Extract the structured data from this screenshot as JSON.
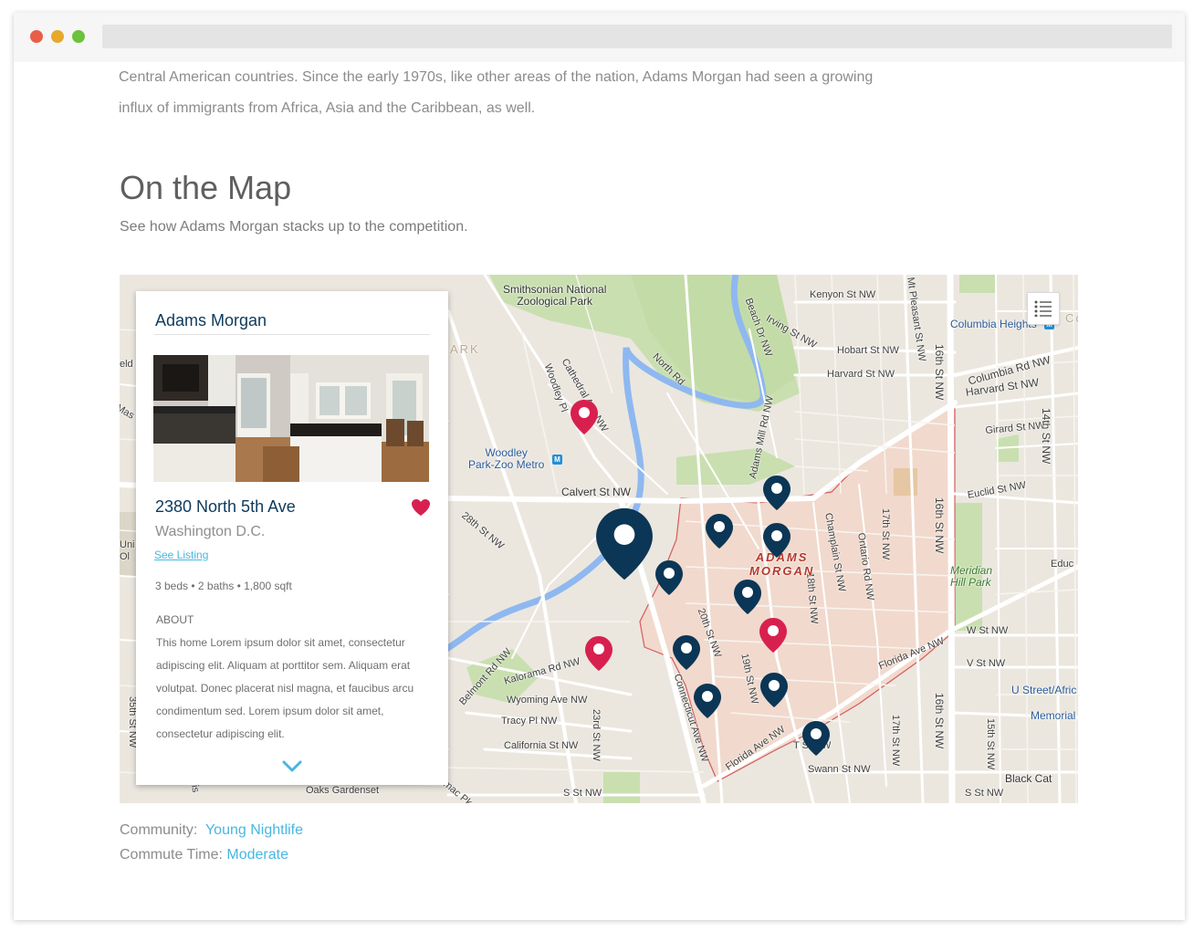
{
  "window": {
    "controls": [
      "close",
      "minimize",
      "maximize"
    ],
    "address_bar": ""
  },
  "intro": {
    "line1": "Central American countries. Since the early 1970s, like other areas of the nation, Adams Morgan had seen a growing",
    "line2": "influx of immigrants from Africa, Asia and the Caribbean, as well."
  },
  "section": {
    "title": "On the Map",
    "subtitle": "See how Adams Morgan stacks up to the competition."
  },
  "map": {
    "neighborhood": "ADAMS\nMORGAN",
    "labels": {
      "zoo": "Smithsonian National\nZoological Park",
      "kenyon": "Kenyon St NW",
      "irving": "Irving St NW",
      "hobart": "Hobart St NW",
      "harvard": "Harvard St NW",
      "harvard2": "Harvard St NW",
      "columbia_rd": "Columbia Rd NW",
      "columbia_heights": "Columbia Heights",
      "girard": "Girard St NW",
      "euclid": "Euclid St NW",
      "calvert": "Calvert St NW",
      "woodley_metro": "Woodley\nPark-Zoo Metro",
      "cathedral": "Cathedral Ave NW",
      "woodley_pl": "Woodley Pl",
      "north_rd": "North Rd",
      "beach_dr": "Beach Dr NW",
      "adams_mill": "Adams Mill Rd NW",
      "mt_pleasant": "Mt Pleasant St NW",
      "st16": "16th St NW",
      "st16b": "16th St NW",
      "st16c": "16th St NW",
      "st14": "14th St NW",
      "st15": "15th St NW",
      "st17": "17th St NW",
      "st17b": "17th St NW",
      "st18": "18th St NW",
      "st19": "19th St NW",
      "st20": "20th St NW",
      "st23": "23rd St NW",
      "st28": "28th St NW",
      "champlain": "Champlain St NW",
      "ontario": "Ontario Rd NW",
      "meridian": "Meridian\nHill Park",
      "w_st": "W St NW",
      "v_st": "V St NW",
      "u_street": "U Street/Afric",
      "memorial": "Memorial",
      "florida": "Florida Ave NW",
      "florida2": "Florida Ave NW",
      "swann": "Swann St NW",
      "t_st": "T St NW",
      "s_st": "S St NW",
      "s_st2": "S St NW",
      "black_cat": "Black Cat",
      "connecticut": "Connecticut Ave NW",
      "kalorama": "Kalorama Rd NW",
      "belmont": "Belmont Rd NW",
      "wyoming": "Wyoming Ave NW",
      "tracy": "Tracy Pl NW",
      "california": "California St NW",
      "oaks": "Oaks Gardenset",
      "ark": "ARK",
      "educ": "Educ",
      "co": "Co",
      "eld": "eld S",
      "mas": "Mas",
      "uni": "Uni\nOl",
      "st35": "35th St NW",
      "wis": "Wis",
      "mac": "mac Pk"
    }
  },
  "card": {
    "title": "Adams Morgan",
    "address": "2380 North 5th Ave",
    "city": "Washington D.C.",
    "link": "See Listing",
    "specs": "3 beds • 2 baths • 1,800 sqft",
    "about_heading": "ABOUT",
    "about_text": "This home Lorem ipsum dolor sit amet, consectetur adipiscing elit. Aliquam at porttitor sem. Aliquam erat volutpat. Donec placerat nisl magna, et faucibus arcu condimentum sed. Lorem ipsum dolor sit amet, consectetur adipiscing elit."
  },
  "meta": {
    "community_label": "Community:",
    "community_value": "Young Nightlife",
    "commute_label": "Commute Time:",
    "commute_value": "Moderate"
  },
  "colors": {
    "pin_navy": "#0b3656",
    "pin_red": "#d8204f",
    "accent_link": "#47b7e0",
    "heart": "#d8204f",
    "neighborhood_fill": "#f1d9cd"
  }
}
